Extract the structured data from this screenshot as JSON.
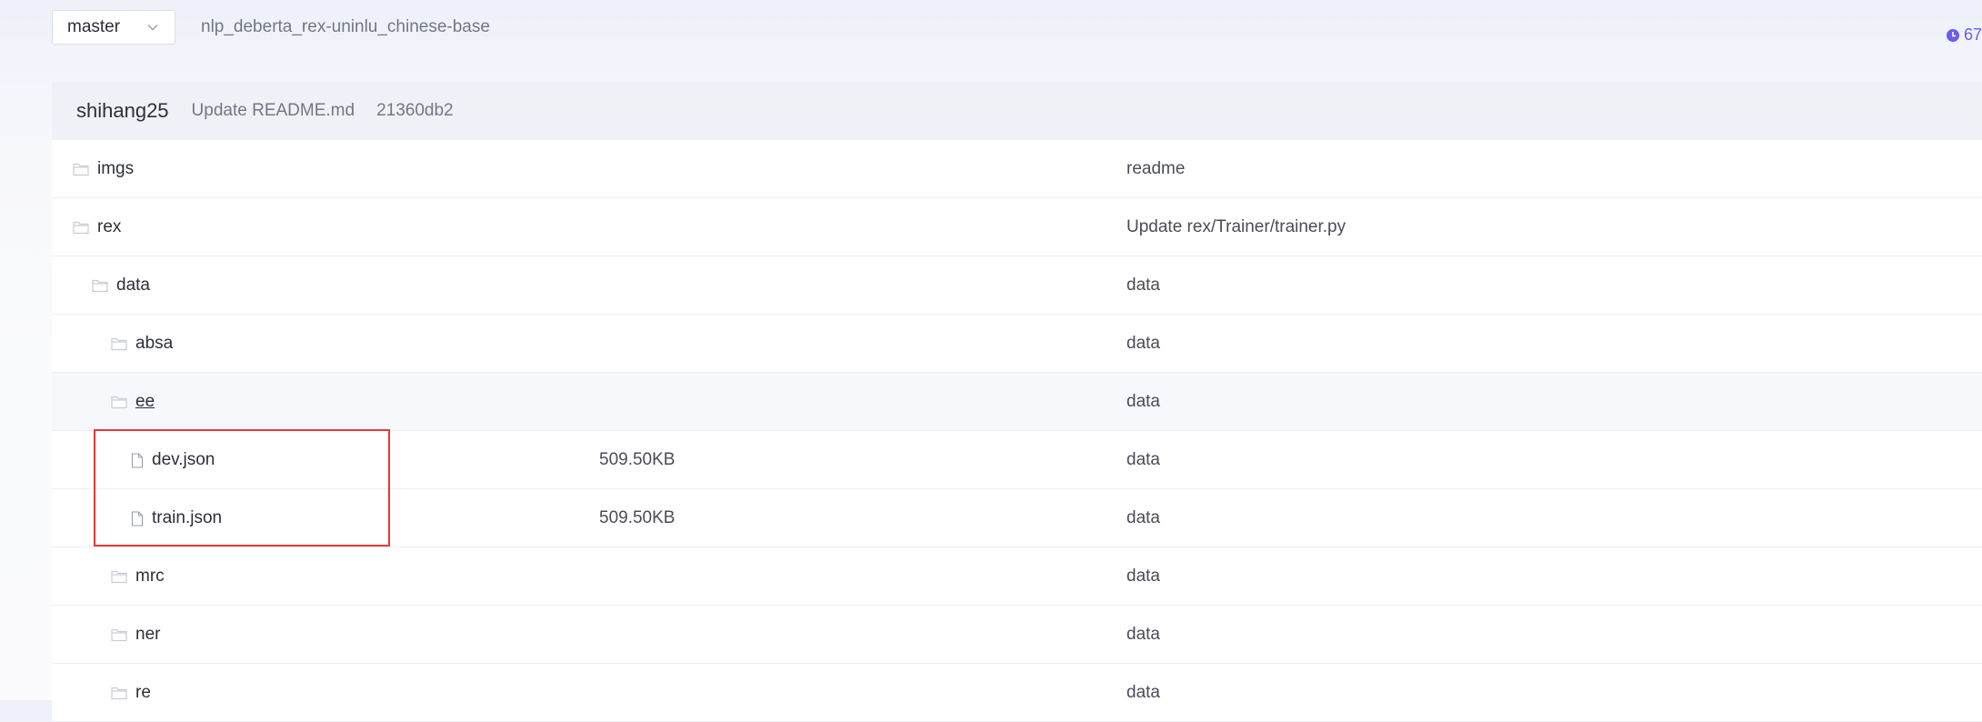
{
  "topbar": {
    "branch": "master",
    "repo_path": "nlp_deberta_rex-uninlu_chinese-base",
    "history_count": "67"
  },
  "commit": {
    "author": "shihang25",
    "message": "Update README.md",
    "hash": "21360db2"
  },
  "files": [
    {
      "name": "imgs",
      "type": "folder",
      "size": "",
      "commit": "readme"
    },
    {
      "name": "rex",
      "type": "folder",
      "size": "",
      "commit": "Update rex/Trainer/trainer.py"
    },
    {
      "name": "data",
      "type": "folder",
      "size": "",
      "commit": "data"
    },
    {
      "name": "absa",
      "type": "folder",
      "size": "",
      "commit": "data"
    },
    {
      "name": "ee",
      "type": "folder",
      "size": "",
      "commit": "data"
    },
    {
      "name": "dev.json",
      "type": "file",
      "size": "509.50KB",
      "commit": "data"
    },
    {
      "name": "train.json",
      "type": "file",
      "size": "509.50KB",
      "commit": "data"
    },
    {
      "name": "mrc",
      "type": "folder",
      "size": "",
      "commit": "data"
    },
    {
      "name": "ner",
      "type": "folder",
      "size": "",
      "commit": "data"
    },
    {
      "name": "re",
      "type": "folder",
      "size": "",
      "commit": "data"
    }
  ],
  "colors": {
    "accent": "#6b5cf0",
    "highlight": "#e53935",
    "folder_icon": "#c9ccd6"
  },
  "icons": {
    "folder": "folder-icon",
    "file": "file-icon",
    "chevron": "chevron-down-icon",
    "history": "clock-icon"
  }
}
